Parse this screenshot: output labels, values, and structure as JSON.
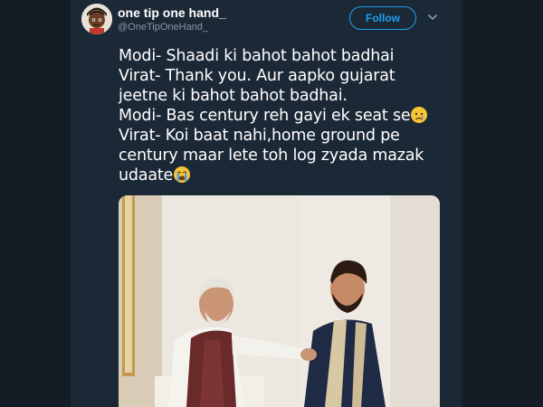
{
  "tweet": {
    "author_name": "one tip one hand_",
    "author_handle": "@OneTipOneHand_",
    "follow_label": "Follow",
    "text_lines": [
      "Modi- Shaadi ki bahot bahot badhai",
      "Virat- Thank you. Aur aapko gujarat",
      "jeetne ki bahot bahot badhai.",
      "Modi- Bas century reh gayi ek seat se",
      "Virat- Koi baat nahi,home ground pe",
      "century maar lete toh log zyada mazak",
      "udaate"
    ],
    "emojis": [
      "crying-face-emoji",
      "loudly-crying-face-emoji"
    ]
  },
  "colors": {
    "background": "#141d26",
    "card": "#1b2836",
    "accent": "#1da1f2",
    "secondary_text": "#8899a6",
    "primary_text": "#ffffff"
  },
  "icons": [
    "chevron-down-icon"
  ]
}
